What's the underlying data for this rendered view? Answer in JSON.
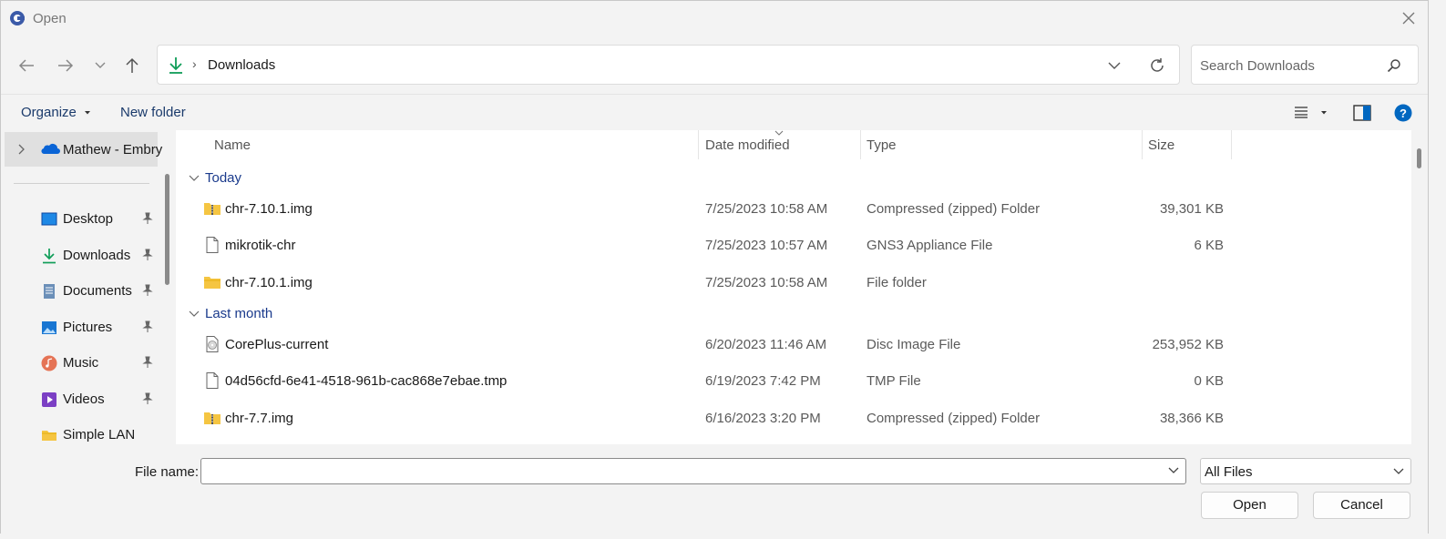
{
  "window": {
    "title": "Open"
  },
  "address": {
    "current": "Downloads",
    "separator": "›"
  },
  "search": {
    "placeholder": "Search Downloads"
  },
  "toolbar": {
    "organize_label": "Organize",
    "new_folder_label": "New folder"
  },
  "sidebar": {
    "onedrive_label": "Mathew - Embry",
    "items": [
      {
        "label": "Desktop",
        "icon": "desktop-icon",
        "pinned": true
      },
      {
        "label": "Downloads",
        "icon": "download-icon",
        "pinned": true
      },
      {
        "label": "Documents",
        "icon": "documents-icon",
        "pinned": true
      },
      {
        "label": "Pictures",
        "icon": "pictures-icon",
        "pinned": true
      },
      {
        "label": "Music",
        "icon": "music-icon",
        "pinned": true
      },
      {
        "label": "Videos",
        "icon": "videos-icon",
        "pinned": true
      },
      {
        "label": "Simple LAN",
        "icon": "folder-icon",
        "pinned": false
      }
    ]
  },
  "columns": {
    "name": "Name",
    "date": "Date modified",
    "type": "Type",
    "size": "Size"
  },
  "groups": [
    {
      "label": "Today",
      "rows": [
        {
          "name": "chr-7.10.1.img",
          "date": "7/25/2023 10:58 AM",
          "type": "Compressed (zipped) Folder",
          "size": "39,301 KB",
          "icon": "zip-folder-icon"
        },
        {
          "name": "mikrotik-chr",
          "date": "7/25/2023 10:57 AM",
          "type": "GNS3 Appliance File",
          "size": "6 KB",
          "icon": "file-icon"
        },
        {
          "name": "chr-7.10.1.img",
          "date": "7/25/2023 10:58 AM",
          "type": "File folder",
          "size": "",
          "icon": "folder-icon"
        }
      ]
    },
    {
      "label": "Last month",
      "rows": [
        {
          "name": "CorePlus-current",
          "date": "6/20/2023 11:46 AM",
          "type": "Disc Image File",
          "size": "253,952 KB",
          "icon": "disc-image-icon"
        },
        {
          "name": "04d56cfd-6e41-4518-961b-cac868e7ebae.tmp",
          "date": "6/19/2023 7:42 PM",
          "type": "TMP File",
          "size": "0 KB",
          "icon": "file-icon"
        },
        {
          "name": "chr-7.7.img",
          "date": "6/16/2023 3:20 PM",
          "type": "Compressed (zipped) Folder",
          "size": "38,366 KB",
          "icon": "zip-folder-icon"
        }
      ]
    }
  ],
  "bottom": {
    "file_name_label": "File name:",
    "file_name_value": "",
    "file_type_value": "All Files",
    "open_label": "Open",
    "cancel_label": "Cancel"
  },
  "colors": {
    "accent": "#0067c0",
    "group_text": "#1a3a8c",
    "download_green": "#0f9d58",
    "folder_yellow": "#f5c542"
  }
}
